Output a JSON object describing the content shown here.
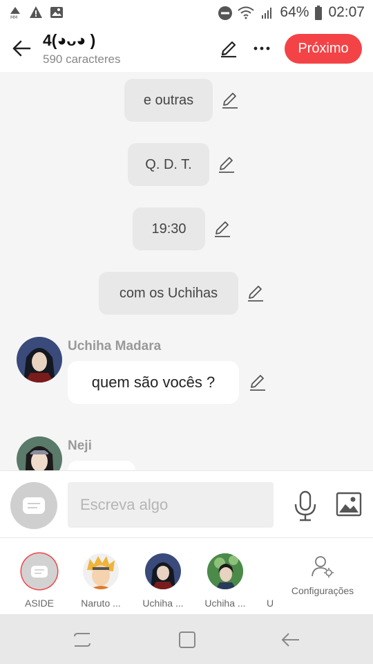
{
  "status": {
    "battery": "64%",
    "time": "02:07"
  },
  "header": {
    "title": "4(◕ᴗ◕ )",
    "subtitle": "590 caracteres",
    "next_label": "Próximo"
  },
  "messages": [
    {
      "text": "e outras"
    },
    {
      "text": "Q. D. T."
    },
    {
      "text": "19:30"
    },
    {
      "text": "com os Uchihas"
    },
    {
      "sender": "Uchiha Madara",
      "text": "quem são vocês ?"
    },
    {
      "sender": "Neji",
      "text": ""
    }
  ],
  "input": {
    "placeholder": "Escreva algo"
  },
  "characters": [
    {
      "label": "ASIDE"
    },
    {
      "label": "Naruto ..."
    },
    {
      "label": "Uchiha ..."
    },
    {
      "label": "Uchiha ..."
    },
    {
      "label": "U"
    }
  ],
  "settings_label": "Configurações",
  "colors": {
    "accent": "#f44346",
    "bubble_gray": "#e8e8e8",
    "background": "#f5f5f5"
  }
}
